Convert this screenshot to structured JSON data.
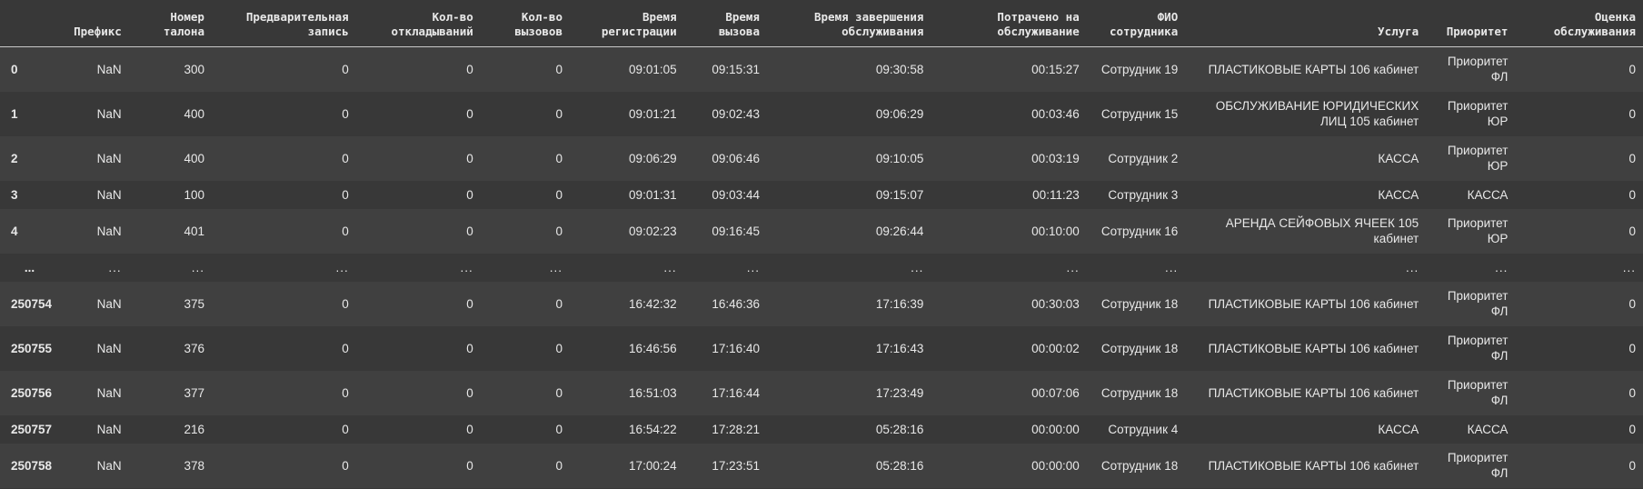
{
  "table": {
    "columns": [
      {
        "key": "index",
        "label": ""
      },
      {
        "key": "prefix",
        "label": "Префикс"
      },
      {
        "key": "ticket",
        "label": "Номер талона"
      },
      {
        "key": "prebook",
        "label": "Предварительная запись"
      },
      {
        "key": "postpone",
        "label": "Кол-во откладываний"
      },
      {
        "key": "calls",
        "label": "Кол-во вызовов"
      },
      {
        "key": "reg_time",
        "label": "Время регистрации"
      },
      {
        "key": "call_time",
        "label": "Время вызова"
      },
      {
        "key": "end_time",
        "label": "Время завершения обслуживания"
      },
      {
        "key": "spent",
        "label": "Потрачено на обслуживание"
      },
      {
        "key": "employee",
        "label": "ФИО сотрудника"
      },
      {
        "key": "service",
        "label": "Услуга"
      },
      {
        "key": "priority",
        "label": "Приоритет"
      },
      {
        "key": "rating",
        "label": "Оценка обслуживания"
      }
    ],
    "rows": [
      {
        "index": "0",
        "prefix": "NaN",
        "ticket": "300",
        "prebook": "0",
        "postpone": "0",
        "calls": "0",
        "reg_time": "09:01:05",
        "call_time": "09:15:31",
        "end_time": "09:30:58",
        "spent": "00:15:27",
        "employee": "Сотрудник 19",
        "service": "ПЛАСТИКОВЫЕ КАРТЫ 106 кабинет",
        "priority": "Приоритет ФЛ",
        "rating": "0"
      },
      {
        "index": "1",
        "prefix": "NaN",
        "ticket": "400",
        "prebook": "0",
        "postpone": "0",
        "calls": "0",
        "reg_time": "09:01:21",
        "call_time": "09:02:43",
        "end_time": "09:06:29",
        "spent": "00:03:46",
        "employee": "Сотрудник 15",
        "service": "ОБСЛУЖИВАНИЕ ЮРИДИЧЕСКИХ ЛИЦ 105 кабинет",
        "priority": "Приоритет ЮР",
        "rating": "0"
      },
      {
        "index": "2",
        "prefix": "NaN",
        "ticket": "400",
        "prebook": "0",
        "postpone": "0",
        "calls": "0",
        "reg_time": "09:06:29",
        "call_time": "09:06:46",
        "end_time": "09:10:05",
        "spent": "00:03:19",
        "employee": "Сотрудник 2",
        "service": "КАССА",
        "priority": "Приоритет ЮР",
        "rating": "0"
      },
      {
        "index": "3",
        "prefix": "NaN",
        "ticket": "100",
        "prebook": "0",
        "postpone": "0",
        "calls": "0",
        "reg_time": "09:01:31",
        "call_time": "09:03:44",
        "end_time": "09:15:07",
        "spent": "00:11:23",
        "employee": "Сотрудник 3",
        "service": "КАССА",
        "priority": "КАССА",
        "rating": "0"
      },
      {
        "index": "4",
        "prefix": "NaN",
        "ticket": "401",
        "prebook": "0",
        "postpone": "0",
        "calls": "0",
        "reg_time": "09:02:23",
        "call_time": "09:16:45",
        "end_time": "09:26:44",
        "spent": "00:10:00",
        "employee": "Сотрудник 16",
        "service": "АРЕНДА СЕЙФОВЫХ ЯЧЕЕК 105 кабинет",
        "priority": "Приоритет ЮР",
        "rating": "0"
      },
      {
        "index": "...",
        "prefix": "...",
        "ticket": "...",
        "prebook": "...",
        "postpone": "...",
        "calls": "...",
        "reg_time": "...",
        "call_time": "...",
        "end_time": "...",
        "spent": "...",
        "employee": "...",
        "service": "...",
        "priority": "...",
        "rating": "..."
      },
      {
        "index": "250754",
        "prefix": "NaN",
        "ticket": "375",
        "prebook": "0",
        "postpone": "0",
        "calls": "0",
        "reg_time": "16:42:32",
        "call_time": "16:46:36",
        "end_time": "17:16:39",
        "spent": "00:30:03",
        "employee": "Сотрудник 18",
        "service": "ПЛАСТИКОВЫЕ КАРТЫ 106 кабинет",
        "priority": "Приоритет ФЛ",
        "rating": "0"
      },
      {
        "index": "250755",
        "prefix": "NaN",
        "ticket": "376",
        "prebook": "0",
        "postpone": "0",
        "calls": "0",
        "reg_time": "16:46:56",
        "call_time": "17:16:40",
        "end_time": "17:16:43",
        "spent": "00:00:02",
        "employee": "Сотрудник 18",
        "service": "ПЛАСТИКОВЫЕ КАРТЫ 106 кабинет",
        "priority": "Приоритет ФЛ",
        "rating": "0"
      },
      {
        "index": "250756",
        "prefix": "NaN",
        "ticket": "377",
        "prebook": "0",
        "postpone": "0",
        "calls": "0",
        "reg_time": "16:51:03",
        "call_time": "17:16:44",
        "end_time": "17:23:49",
        "spent": "00:07:06",
        "employee": "Сотрудник 18",
        "service": "ПЛАСТИКОВЫЕ КАРТЫ 106 кабинет",
        "priority": "Приоритет ФЛ",
        "rating": "0"
      },
      {
        "index": "250757",
        "prefix": "NaN",
        "ticket": "216",
        "prebook": "0",
        "postpone": "0",
        "calls": "0",
        "reg_time": "16:54:22",
        "call_time": "17:28:21",
        "end_time": "05:28:16",
        "spent": "00:00:00",
        "employee": "Сотрудник 4",
        "service": "КАССА",
        "priority": "КАССА",
        "rating": "0"
      },
      {
        "index": "250758",
        "prefix": "NaN",
        "ticket": "378",
        "prebook": "0",
        "postpone": "0",
        "calls": "0",
        "reg_time": "17:00:24",
        "call_time": "17:23:51",
        "end_time": "05:28:16",
        "spent": "00:00:00",
        "employee": "Сотрудник 18",
        "service": "ПЛАСТИКОВЫЕ КАРТЫ 106 кабинет",
        "priority": "Приоритет ФЛ",
        "rating": "0"
      }
    ]
  }
}
